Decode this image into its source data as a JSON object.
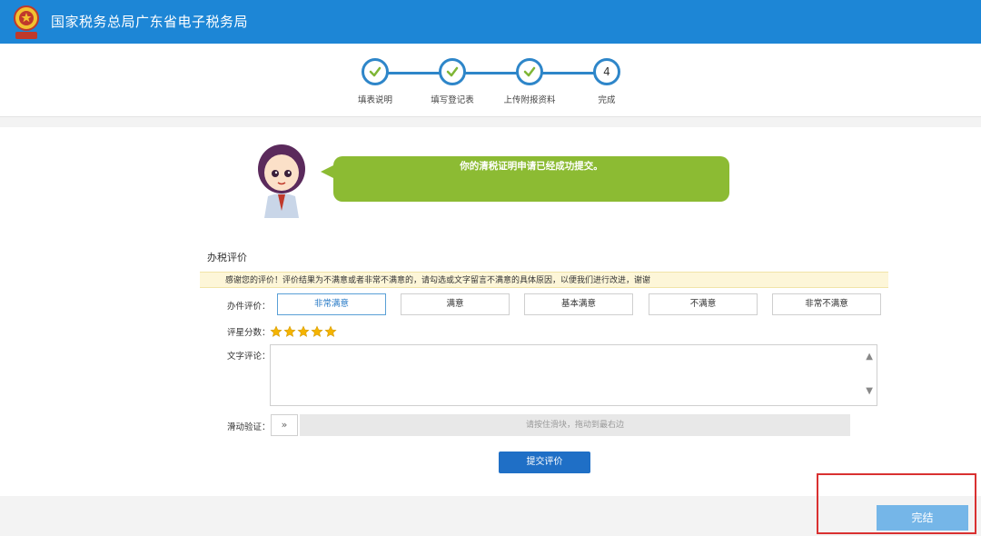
{
  "header": {
    "title": "国家税务总局广东省电子税务局"
  },
  "steps": [
    {
      "label": "填表说明",
      "state": "done",
      "icon": "check-icon"
    },
    {
      "label": "填写登记表",
      "state": "done",
      "icon": "check-icon"
    },
    {
      "label": "上传附报资料",
      "state": "done",
      "icon": "check-icon"
    },
    {
      "label": "完成",
      "state": "current",
      "number": "4"
    }
  ],
  "message": {
    "text": "你的清税证明申请已经成功提交。"
  },
  "evaluation": {
    "title": "办税评价",
    "notice": "感谢您的评价！评价结果为不满意或者非常不满意的，请勾选或文字留言不满意的具体原因，以便我们进行改进，谢谢",
    "rating_label": "办件评价：",
    "rating_options": [
      "非常满意",
      "满意",
      "基本满意",
      "不满意",
      "非常不满意"
    ],
    "selected_rating": "非常满意",
    "score_label": "评星分数：",
    "stars": 5,
    "comment_label": "文字评论：",
    "comment_value": "",
    "slider_label": "滑动验证：",
    "slider_handle": "»",
    "slider_hint": "请按住滑块，拖动到最右边",
    "submit_label": "提交评价"
  },
  "footer": {
    "done_label": "完结"
  },
  "colors": {
    "header": "#1d86d6",
    "step_accent": "#2e86c9",
    "bubble": "#8cbb33",
    "submit": "#1f6fc6",
    "done": "#75b6e8",
    "highlight": "#d93131"
  }
}
